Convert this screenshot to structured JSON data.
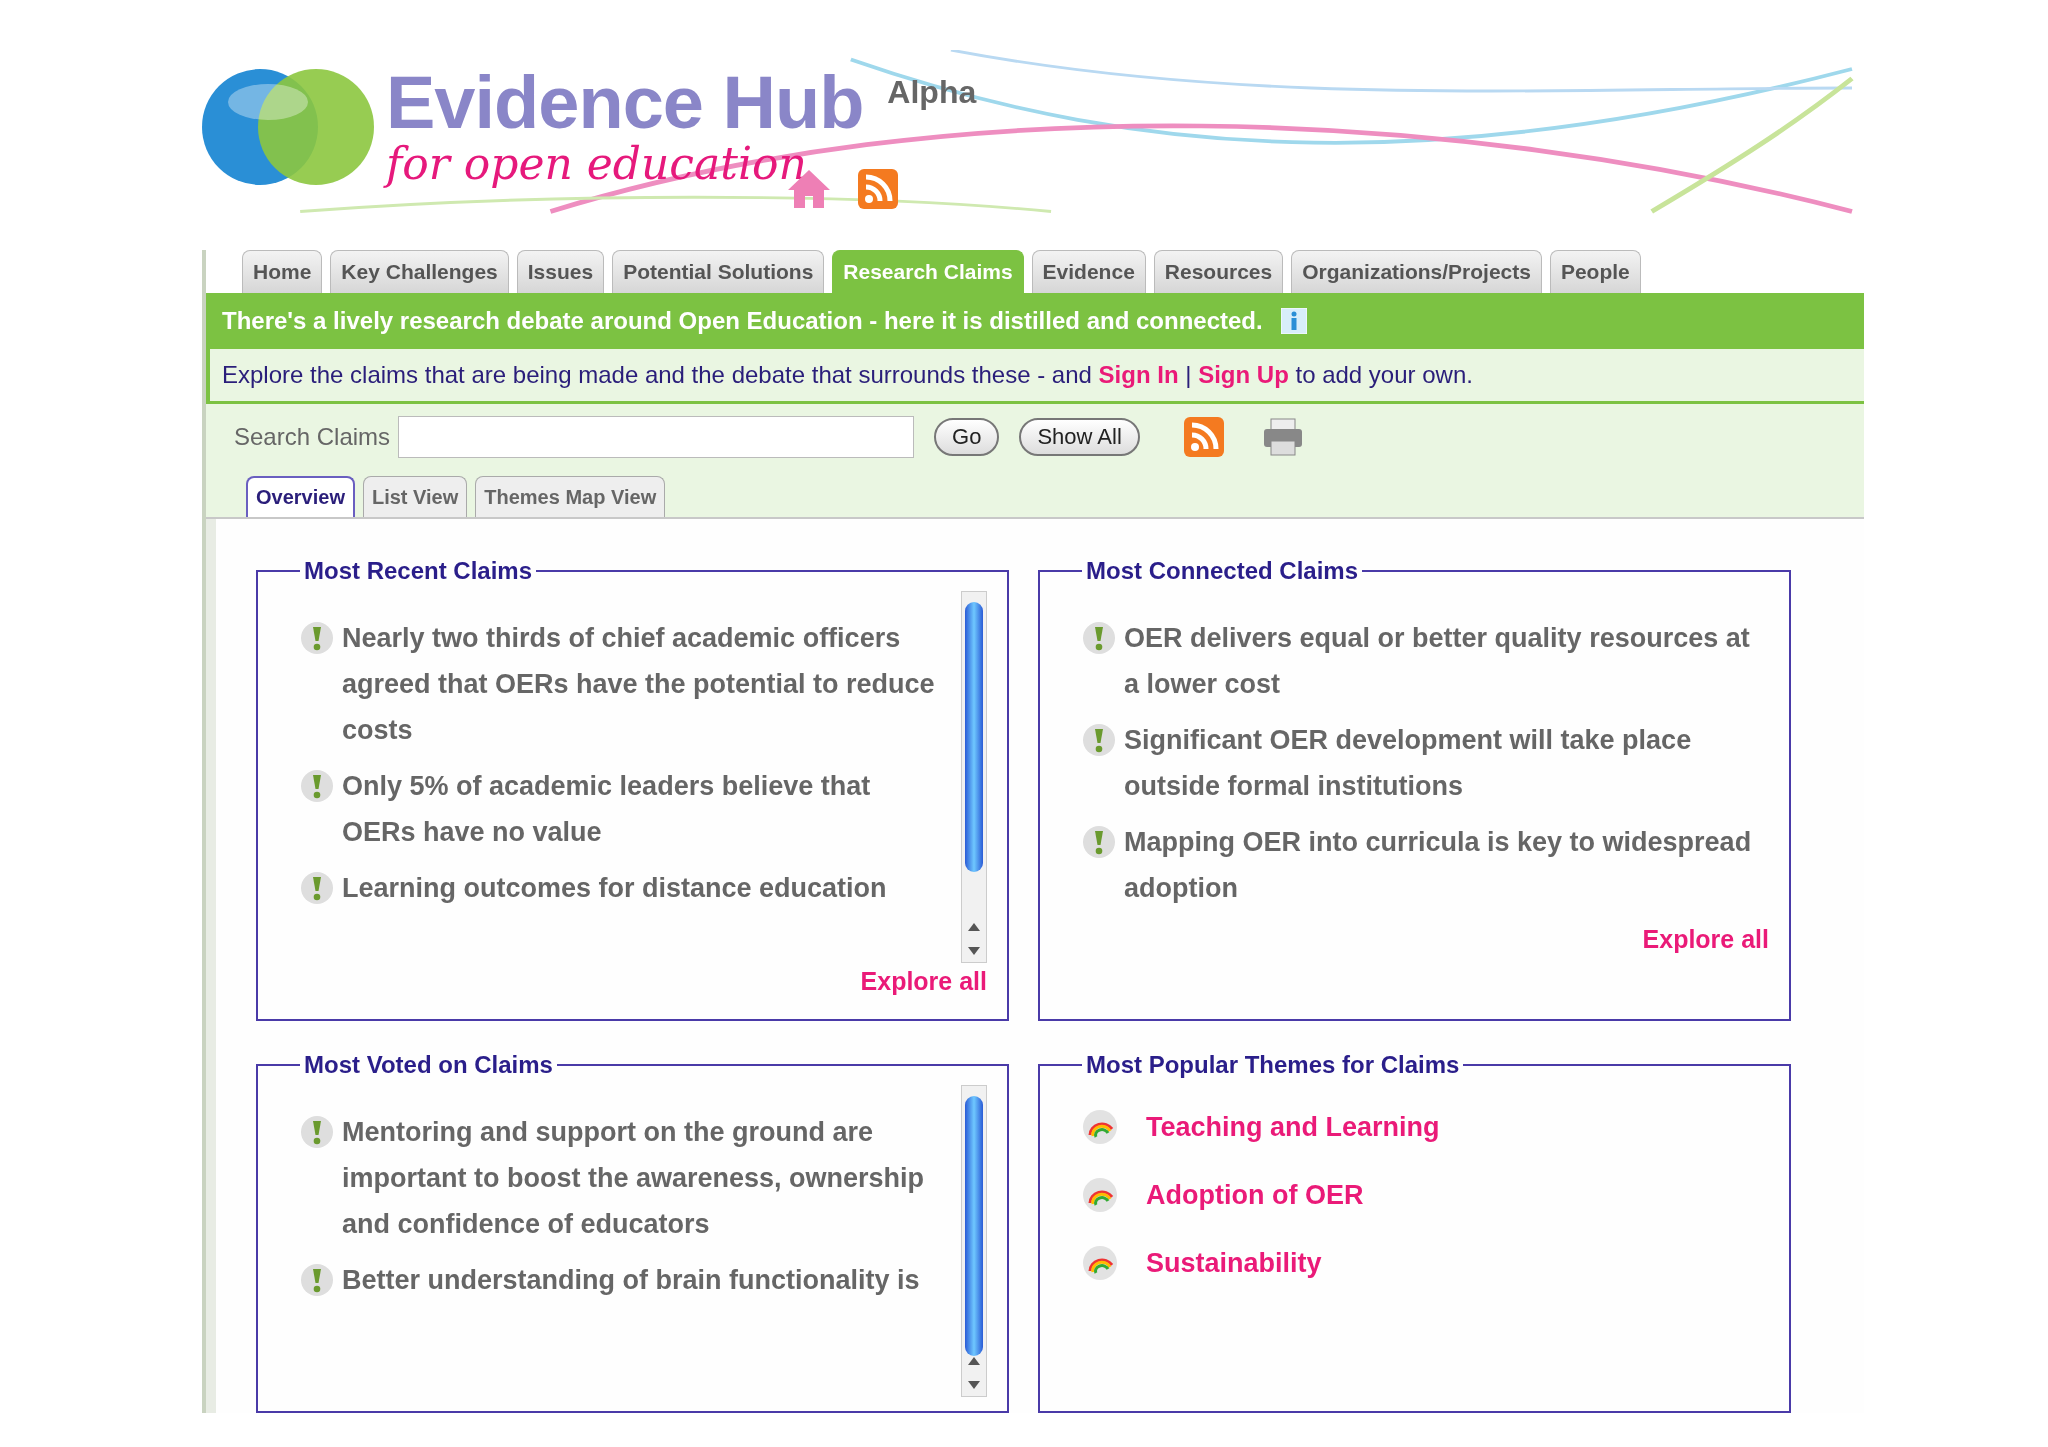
{
  "header": {
    "logo_title": "Evidence Hub",
    "logo_subtitle": "for open education",
    "badge": "Alpha"
  },
  "nav_tabs": [
    {
      "label": "Home",
      "selected": false
    },
    {
      "label": "Key Challenges",
      "selected": false
    },
    {
      "label": "Issues",
      "selected": false
    },
    {
      "label": "Potential Solutions",
      "selected": false
    },
    {
      "label": "Research Claims",
      "selected": true
    },
    {
      "label": "Evidence",
      "selected": false
    },
    {
      "label": "Resources",
      "selected": false
    },
    {
      "label": "Organizations/Projects",
      "selected": false
    },
    {
      "label": "People",
      "selected": false
    }
  ],
  "banner": {
    "headline": "There's a lively research debate around Open Education - here it is distilled and connected.",
    "before": "Explore the claims that are being made and the debate that surrounds these - and",
    "sign_in": "Sign In",
    "separator": "|",
    "sign_up": "Sign Up",
    "after": "to add your own."
  },
  "search": {
    "label": "Search Claims",
    "go": "Go",
    "show_all": "Show All"
  },
  "view_tabs": [
    {
      "label": "Overview",
      "selected": true
    },
    {
      "label": "List View",
      "selected": false
    },
    {
      "label": "Themes Map View",
      "selected": false
    }
  ],
  "panels": [
    {
      "title": "Most Recent Claims",
      "kind": "claims",
      "scrollable": true,
      "explore": "Explore all",
      "items": [
        "Nearly two thirds of chief academic officers agreed that OERs have the potential to reduce costs",
        "Only 5% of academic leaders believe that OERs have no value",
        "Learning outcomes for distance education"
      ]
    },
    {
      "title": "Most Connected Claims",
      "kind": "claims",
      "scrollable": false,
      "explore": "Explore all",
      "items": [
        "OER delivers equal or better quality resources at a lower cost",
        "Significant OER development will take place outside formal institutions",
        "Mapping OER into curricula is key to widespread adoption"
      ]
    },
    {
      "title": "Most Voted on Claims",
      "kind": "claims",
      "scrollable": true,
      "items": [
        "Mentoring and support on the ground are important to boost the awareness, ownership and confidence of educators",
        "Better understanding of brain functionality is"
      ]
    },
    {
      "title": "Most Popular Themes for Claims",
      "kind": "themes",
      "scrollable": false,
      "items": [
        "Teaching and Learning",
        "Adoption of OER",
        "Sustainability"
      ]
    }
  ]
}
